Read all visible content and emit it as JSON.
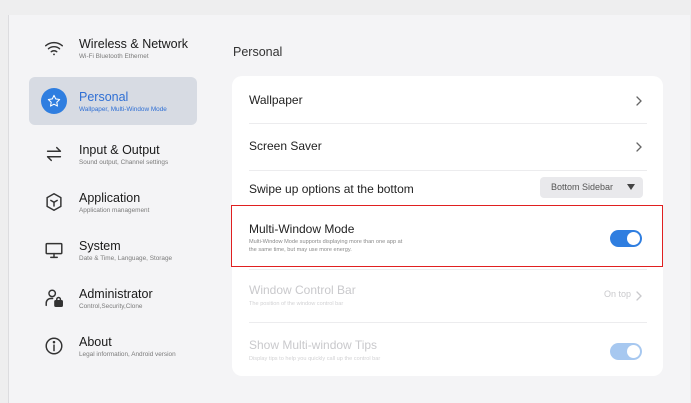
{
  "sidebar": {
    "items": [
      {
        "title": "Wireless & Network",
        "subtitle": "Wi-Fi Bluetooth Ethernet",
        "icon": "wifi-icon"
      },
      {
        "title": "Personal",
        "subtitle": "Wallpaper, Multi-Window Mode",
        "icon": "star-icon"
      },
      {
        "title": "Input & Output",
        "subtitle": "Sound output, Channel settings",
        "icon": "swap-arrows-icon"
      },
      {
        "title": "Application",
        "subtitle": "Application management",
        "icon": "cube-icon"
      },
      {
        "title": "System",
        "subtitle": "Date & Time, Language, Storage",
        "icon": "monitor-icon"
      },
      {
        "title": "Administrator",
        "subtitle": "Control,Security,Clone",
        "icon": "admin-lock-icon"
      },
      {
        "title": "About",
        "subtitle": "Legal information, Android version",
        "icon": "info-icon"
      }
    ],
    "active_index": 1
  },
  "main": {
    "title": "Personal",
    "rows": {
      "wallpaper": {
        "label": "Wallpaper"
      },
      "screen_saver": {
        "label": "Screen Saver"
      },
      "swipe_up": {
        "label": "Swipe up options at the bottom",
        "selected": "Bottom Sidebar"
      },
      "multi_window": {
        "label": "Multi-Window Mode",
        "description_line1": "Multi-Window Mode supports displaying more than one app at",
        "description_line2": "the same time, but may use more energy.",
        "enabled": true
      },
      "window_control_bar": {
        "label": "Window Control Bar",
        "description": "The position of the window control bar",
        "value": "On top"
      },
      "multi_window_tips": {
        "label": "Show Multi-window Tips",
        "description": "Display tips to help you quickly call up the control bar",
        "enabled": true
      }
    }
  },
  "colors": {
    "accent": "#2f7ee0",
    "active_sidebar_bg": "#d7dbe3",
    "highlight_border": "#e02020"
  }
}
